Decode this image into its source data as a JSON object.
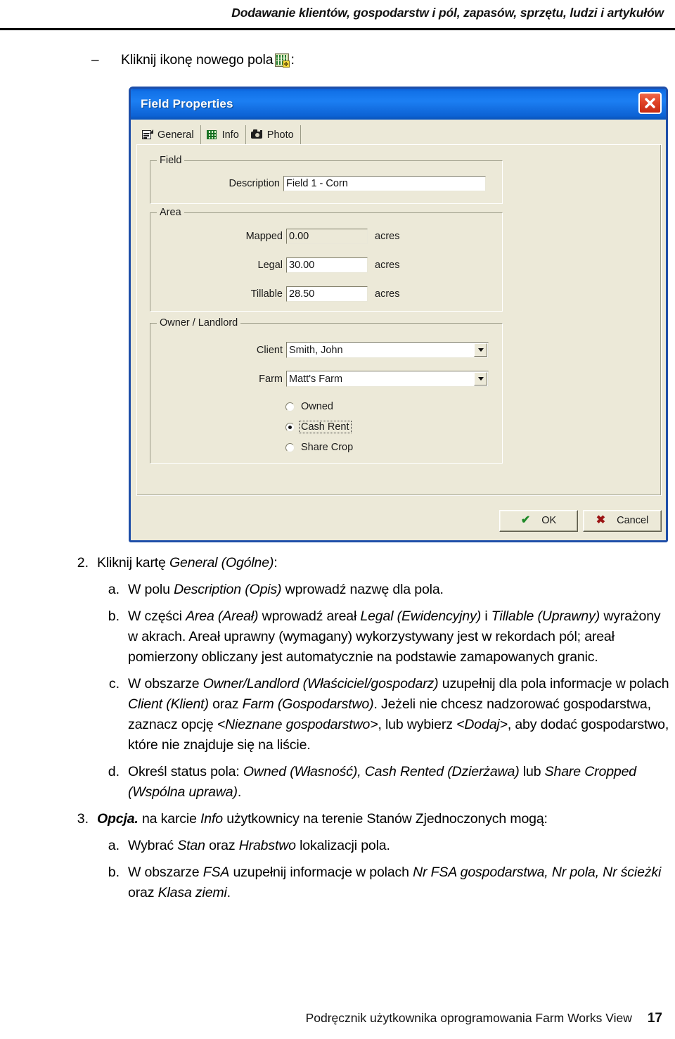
{
  "header": {
    "running_head": "Dodawanie klientów, gospodarstw i pól, zapasów, sprzętu, ludzi i artykułów"
  },
  "intro": {
    "dash": "–",
    "text_before_icon": "Kliknij ikonę nowego pola",
    "icon_name": "new-field-icon",
    "text_after_icon": ":"
  },
  "dialog": {
    "title": "Field Properties",
    "close_label": "×",
    "tabs": [
      {
        "label": "General",
        "icon": "general-card-icon",
        "active": true
      },
      {
        "label": "Info",
        "icon": "info-grid-icon",
        "active": false
      },
      {
        "label": "Photo",
        "icon": "camera-icon",
        "active": false
      }
    ],
    "field_group": {
      "legend": "Field",
      "description_label": "Description",
      "description_value": "Field 1 - Corn"
    },
    "area_group": {
      "legend": "Area",
      "unit": "acres",
      "rows": [
        {
          "label": "Mapped",
          "value": "0.00",
          "readonly": true
        },
        {
          "label": "Legal",
          "value": "30.00",
          "readonly": false
        },
        {
          "label": "Tillable",
          "value": "28.50",
          "readonly": false
        }
      ]
    },
    "owner_group": {
      "legend": "Owner / Landlord",
      "client_label": "Client",
      "client_value": "Smith, John",
      "farm_label": "Farm",
      "farm_value": "Matt's Farm",
      "radios": [
        {
          "label": "Owned",
          "checked": false,
          "focused": false
        },
        {
          "label": "Cash Rent",
          "checked": true,
          "focused": true
        },
        {
          "label": "Share Crop",
          "checked": false,
          "focused": false
        }
      ]
    },
    "buttons": {
      "ok": "OK",
      "ok_glyph": "✔",
      "cancel": "Cancel",
      "cancel_glyph": "✖"
    },
    "colors": {
      "titlebar_blue": "#1272e8",
      "dialog_face": "#ece9d8",
      "border_blue": "#1e4ea8",
      "close_red": "#e04326"
    }
  },
  "steps": [
    {
      "marker": "2.",
      "level": 1,
      "html": "Kliknij kartę <span class=\"it\">General (Ogólne)</span>:"
    },
    {
      "marker": "a.",
      "level": 2,
      "html": "W polu <span class=\"it\">Description (Opis)</span> wprowadź nazwę dla pola."
    },
    {
      "marker": "b.",
      "level": 2,
      "html": "W części <span class=\"it\">Area (Areał)</span> wprowadź areał <span class=\"it\">Legal (Ewidencyjny)</span> i <span class=\"it\">Tillable (Uprawny)</span> wyrażony w akrach. Areał uprawny (wymagany) wykorzystywany jest w rekordach pól; areał pomierzony obliczany jest automatycznie na podstawie zamapowanych granic."
    },
    {
      "marker": "c.",
      "level": 2,
      "html": "W obszarze <span class=\"it\">Owner/Landlord (Właściciel/gospodarz)</span> uzupełnij dla pola informacje w polach <span class=\"it\">Client (Klient)</span> oraz <span class=\"it\">Farm (Gospodarstwo)</span>. Jeżeli nie chcesz nadzorować gospodarstwa, zaznacz opcję <span class=\"it\">&lt;Nieznane gospodarstwo&gt;</span>, lub wybierz <span class=\"it\">&lt;Dodaj&gt;</span>, aby dodać gospodarstwo, które nie znajduje się na liście."
    },
    {
      "marker": "d.",
      "level": 2,
      "html": "Określ status pola: <span class=\"it\">Owned (Własność), Cash Rented (Dzierżawa)</span> lub <span class=\"it\">Share Cropped (Wspólna uprawa)</span>."
    },
    {
      "marker": "3.",
      "level": 1,
      "html": "<span class=\"bi\">Opcja.</span> na karcie <span class=\"it\">Info</span> użytkownicy na terenie Stanów Zjednoczonych mogą:"
    },
    {
      "marker": "a.",
      "level": 2,
      "html": "Wybrać <span class=\"it\">Stan</span> oraz <span class=\"it\">Hrabstwo</span> lokalizacji pola."
    },
    {
      "marker": "b.",
      "level": 2,
      "html": "W obszarze <span class=\"it\">FSA</span> uzupełnij informacje w polach <span class=\"it\">Nr FSA gospodarstwa, Nr pola, Nr ścieżki</span> oraz <span class=\"it\">Klasa ziemi</span>."
    }
  ],
  "footer": {
    "text": "Podręcznik użytkownika oprogramowania Farm Works View",
    "page_number": "17"
  }
}
